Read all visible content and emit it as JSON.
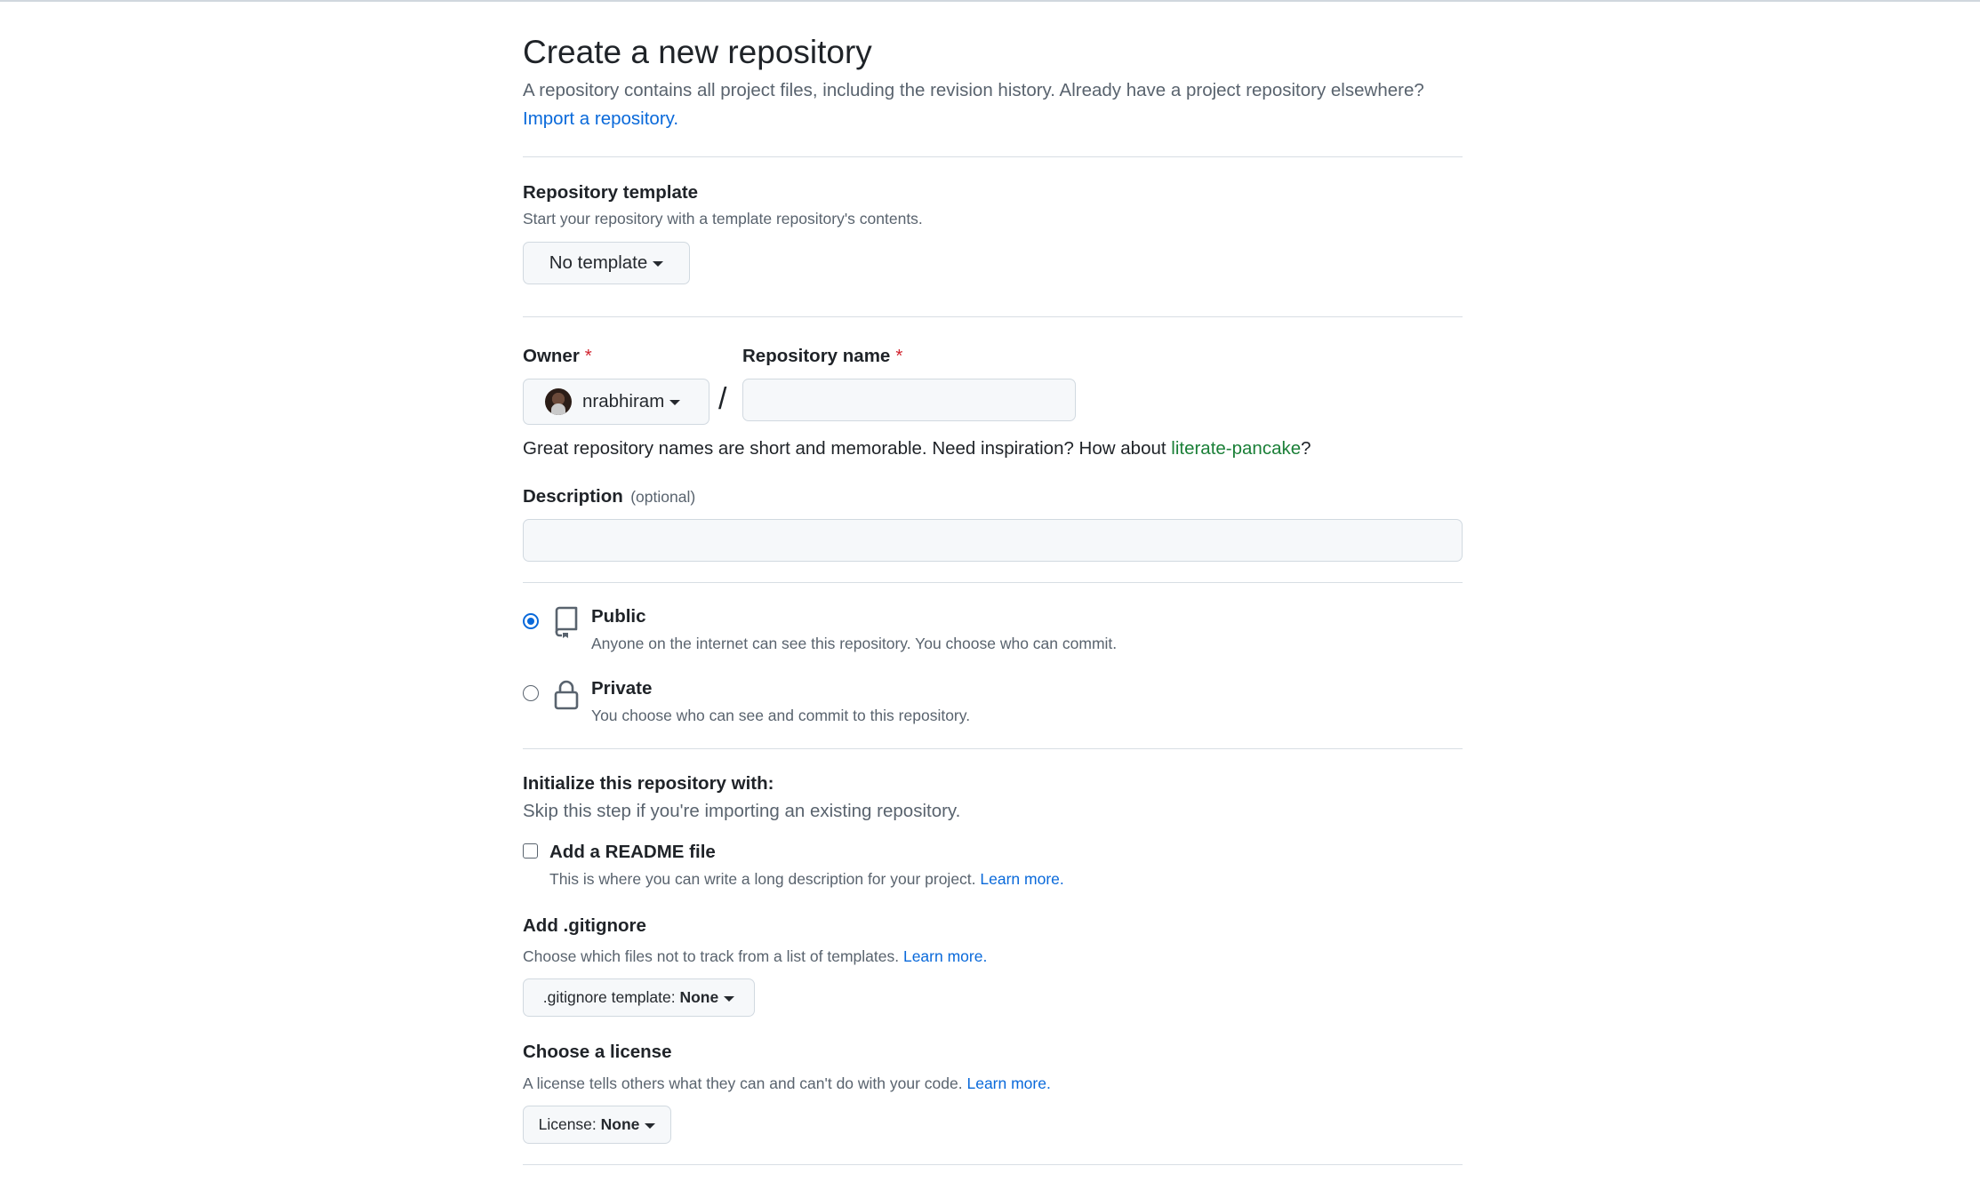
{
  "header": {
    "title": "Create a new repository",
    "subtitle": "A repository contains all project files, including the revision history. Already have a project repository elsewhere?",
    "import_link": "Import a repository."
  },
  "template": {
    "label": "Repository template",
    "note": "Start your repository with a template repository's contents.",
    "button": "No template"
  },
  "owner": {
    "label": "Owner",
    "required_mark": "*",
    "value": "nrabhiram",
    "avatar_icon": "user-avatar"
  },
  "separator": "/",
  "repo_name": {
    "label": "Repository name",
    "required_mark": "*",
    "value": ""
  },
  "name_hint": {
    "prefix": "Great repository names are short and memorable. Need inspiration? How about ",
    "suggestion": "literate-pancake",
    "suffix": "?"
  },
  "description": {
    "label": "Description",
    "optional": "(optional)",
    "value": ""
  },
  "visibility": {
    "options": [
      {
        "label": "Public",
        "note": "Anyone on the internet can see this repository. You choose who can commit.",
        "icon": "repo-icon",
        "checked": true
      },
      {
        "label": "Private",
        "note": "You choose who can see and commit to this repository.",
        "icon": "lock-icon",
        "checked": false
      }
    ]
  },
  "initialize": {
    "label": "Initialize this repository with:",
    "note": "Skip this step if you're importing an existing repository."
  },
  "readme": {
    "label": "Add a README file",
    "note": "This is where you can write a long description for your project.",
    "link": "Learn more.",
    "checked": false
  },
  "gitignore": {
    "label": "Add .gitignore",
    "note": "Choose which files not to track from a list of templates.",
    "link": "Learn more.",
    "button_prefix": ".gitignore template: ",
    "button_value": "None"
  },
  "license": {
    "label": "Choose a license",
    "note": "A license tells others what they can and can't do with your code.",
    "link": "Learn more.",
    "button_prefix": "License: ",
    "button_value": "None"
  },
  "colors": {
    "accent": "#0969da",
    "required": "#d1242f",
    "suggestion": "#1a7f37"
  }
}
